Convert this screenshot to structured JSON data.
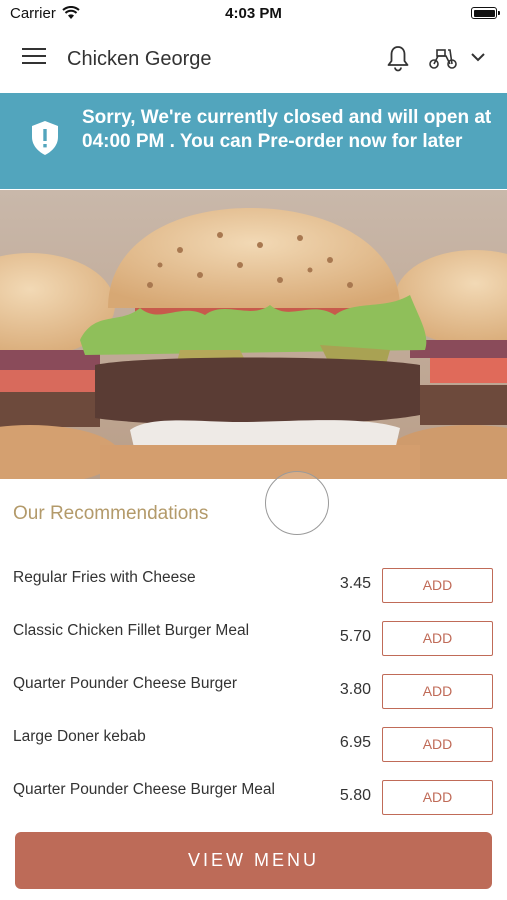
{
  "status_bar": {
    "carrier": "Carrier",
    "time": "4:03 PM"
  },
  "header": {
    "title": "Chicken George",
    "icons": [
      "menu-icon",
      "bell-icon",
      "scooter-icon",
      "chevron-down-icon"
    ]
  },
  "banner": {
    "message": "Sorry, We're currently closed and will open at 04:00 PM . You can Pre-order now for later",
    "color": "#52a5bd"
  },
  "recommendations": {
    "title": "Our Recommendations",
    "items": [
      {
        "name": "Regular Fries with Cheese",
        "price": "3.45",
        "button": "ADD"
      },
      {
        "name": "Classic Chicken Fillet Burger Meal",
        "price": "5.70",
        "button": "ADD"
      },
      {
        "name": "Quarter Pounder Cheese Burger",
        "price": "3.80",
        "button": "ADD"
      },
      {
        "name": "Large Doner kebab",
        "price": "6.95",
        "button": "ADD"
      },
      {
        "name": "Quarter Pounder Cheese Burger Meal",
        "price": "5.80",
        "button": "ADD"
      }
    ]
  },
  "footer": {
    "view_menu_label": "VIEW MENU",
    "accent": "#bd6b58"
  }
}
